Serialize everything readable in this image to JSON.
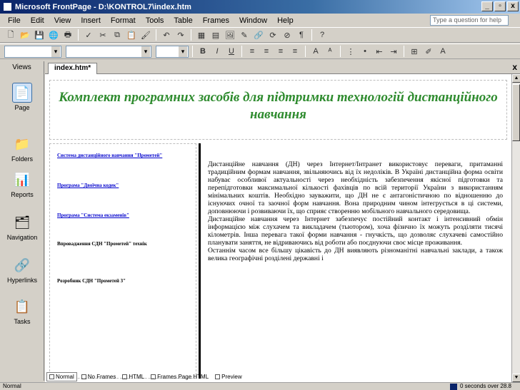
{
  "window": {
    "title": "Microsoft FrontPage - D:\\KONTROL7\\index.htm",
    "controls": [
      "_",
      "▫",
      "x"
    ]
  },
  "menu": {
    "items": [
      "File",
      "Edit",
      "View",
      "Insert",
      "Format",
      "Tools",
      "Table",
      "Frames",
      "Window",
      "Help"
    ],
    "help_placeholder": "Type a question for help"
  },
  "views": {
    "header": "Views",
    "items": [
      {
        "label": "Page",
        "icon": "page-icon"
      },
      {
        "label": "Folders",
        "icon": "folders-icon"
      },
      {
        "label": "Reports",
        "icon": "reports-icon"
      },
      {
        "label": "Navigation",
        "icon": "navigation-icon"
      },
      {
        "label": "Hyperlinks",
        "icon": "hyperlinks-icon"
      },
      {
        "label": "Tasks",
        "icon": "tasks-icon"
      }
    ]
  },
  "document": {
    "tab": "index.htm*",
    "close": "x"
  },
  "page": {
    "banner": "Комплект програмних засобів для підтримки технологій дистанційного навчання",
    "left_links": [
      "Система дистанційного навчання \"Прометей\"",
      "Програма \"Двоїчна кодек\"",
      "Програма \"Система екзаменів\""
    ],
    "left_text": [
      "Впровадження СДН \"Прометей\" технік",
      "Розробник СДН \"Прометей 3\""
    ],
    "main_paragraphs": [
      "Дистанційне навчання (ДН) через Інтернет/Інтранет використовує переваги, притаманні традиційним формам навчання, звільняючись від їх недоліків. В Україні дистанційна форма освіти набуває особливої актуальності через необхідність забезпечення якісної підготовки та перепідготовки максимальної кількості фахівців по всій території України з використанням мінімальних коштів. Необхідно зауважити, що ДН не є антагоністичною по відношенню до існуючих очної та заочної форм навчання. Вона природним чином інтегрується в ці системи, доповнюючи і розвиваючи їх, що сприяє створенню мобільного навчального середовища.",
      "Дистанційне навчання через Інтернет забезпечує постійний контакт і інтенсивний обмін інформацією між слухачем та викладачем (тьютором), хоча фізично їх можуть розділяти тисячі кілометрів. Інша перевага такої форми навчання - гнучкість, що дозволяє слухачеві самостійно планувати заняття, не відриваючись від роботи або поєднуючи своє місце проживання.",
      "Останнім часом все більшу цікавість до ДН виявляють різноманітні навчальні заклади, а також велика географічні розділені державні і"
    ]
  },
  "view_tabs": [
    "Normal",
    "No Frames",
    "HTML",
    "Frames Page HTML",
    "Preview"
  ],
  "status": {
    "left": "Normal",
    "right": "0 seconds over 28.8"
  }
}
